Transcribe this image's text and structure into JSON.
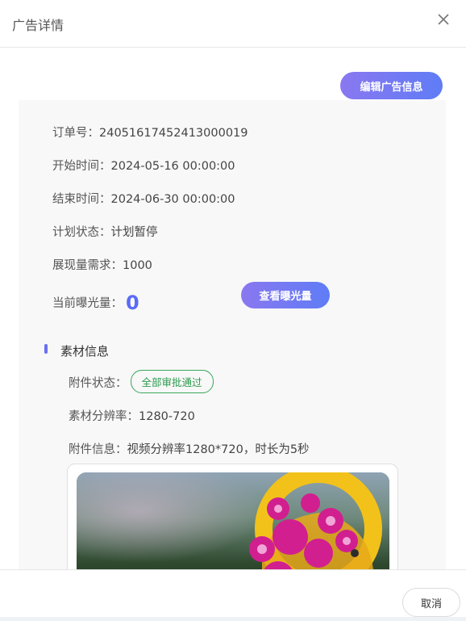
{
  "dialog": {
    "title": "广告详情",
    "close_icon": "close-icon"
  },
  "actions": {
    "edit_label": "编辑广告信息",
    "view_exposure_label": "查看曝光量",
    "cancel_label": "取消"
  },
  "order": {
    "order_no_label": "订单号：",
    "order_no": "24051617452413000019",
    "start_label": "开始时间：",
    "start": "2024-05-16 00:00:00",
    "end_label": "结束时间：",
    "end": "2024-06-30 00:00:00",
    "plan_status_label": "计划状态：",
    "plan_status": "计划暂停",
    "impression_demand_label": "展现量需求：",
    "impression_demand": "1000",
    "current_exposure_label": "当前曝光量：",
    "current_exposure": "0"
  },
  "material": {
    "section_title": "素材信息",
    "attachment_status_label": "附件状态：",
    "attachment_status": "全部审批通过",
    "resolution_label": "素材分辨率：",
    "resolution": "1280-720",
    "attachment_info_label": "附件信息：",
    "attachment_info": "视频分辨率1280*720，时长为5秒"
  },
  "colors": {
    "accent_gradient_start": "#8a78f0",
    "accent_gradient_end": "#5f7cf6",
    "success": "#2e9b4f",
    "exposure_number": "#5b6af6"
  }
}
